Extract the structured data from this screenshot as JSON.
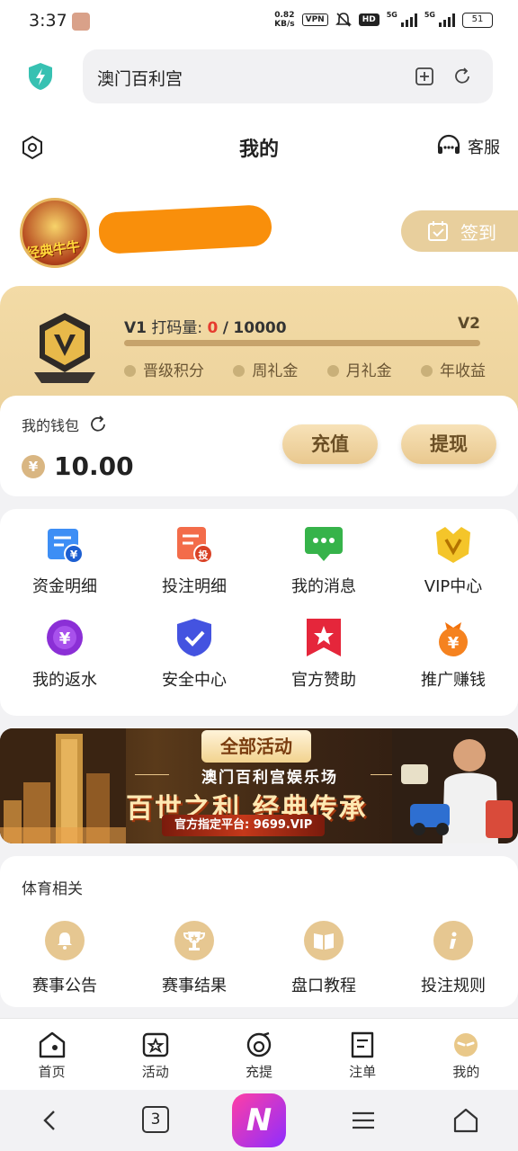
{
  "status_bar": {
    "time": "3:37",
    "net_speed_value": "0.82",
    "net_speed_unit": "KB/s",
    "vpn": "VPN",
    "hd": "HD",
    "sig1": "5G",
    "sig2": "5G",
    "battery": "51"
  },
  "browser": {
    "url_text": "澳门百利宫"
  },
  "header": {
    "title": "我的",
    "customer_service": "客服",
    "avatar_text": "经典牛牛",
    "signin": "签到"
  },
  "vip": {
    "level": "V1",
    "bet_label": "打码量:",
    "bet_current": "0",
    "bet_sep": "/",
    "bet_target": "10000",
    "next_level": "V2",
    "progress": 0,
    "perks": [
      "晋级积分",
      "周礼金",
      "月礼金",
      "年收益"
    ]
  },
  "wallet": {
    "label": "我的钱包",
    "currency_symbol": "¥",
    "amount": "10.00",
    "recharge": "充值",
    "withdraw": "提现"
  },
  "menu": {
    "items": [
      {
        "label": "资金明细",
        "icon": "fund-details-icon"
      },
      {
        "label": "投注明细",
        "icon": "bet-details-icon"
      },
      {
        "label": "我的消息",
        "icon": "message-icon"
      },
      {
        "label": "VIP中心",
        "icon": "vip-icon"
      },
      {
        "label": "我的返水",
        "icon": "rebate-icon"
      },
      {
        "label": "安全中心",
        "icon": "security-shield-icon"
      },
      {
        "label": "官方赞助",
        "icon": "sponsor-icon"
      },
      {
        "label": "推广赚钱",
        "icon": "promote-icon"
      }
    ]
  },
  "banner": {
    "tab": "全部活动",
    "subtitle": "澳门百利宫娱乐场",
    "headline": "百世之利 经典传承",
    "platform": "官方指定平台: 9699.VIP"
  },
  "sports": {
    "title": "体育相关",
    "items": [
      {
        "label": "赛事公告",
        "icon": "bell-icon"
      },
      {
        "label": "赛事结果",
        "icon": "trophy-icon"
      },
      {
        "label": "盘口教程",
        "icon": "book-icon"
      },
      {
        "label": "投注规则",
        "icon": "info-icon"
      }
    ]
  },
  "tabbar": {
    "items": [
      {
        "label": "首页",
        "icon": "home-icon"
      },
      {
        "label": "活动",
        "icon": "activity-star-icon"
      },
      {
        "label": "充提",
        "icon": "deposit-icon"
      },
      {
        "label": "注单",
        "icon": "bet-slip-icon"
      },
      {
        "label": "我的",
        "icon": "profile-icon"
      }
    ]
  },
  "sysnav": {
    "tabs_count": "3",
    "app_letter": "N"
  },
  "colors": {
    "gold": "#e8cf9d",
    "accent_red": "#e63b2e",
    "redaction": "#f98f0b"
  }
}
